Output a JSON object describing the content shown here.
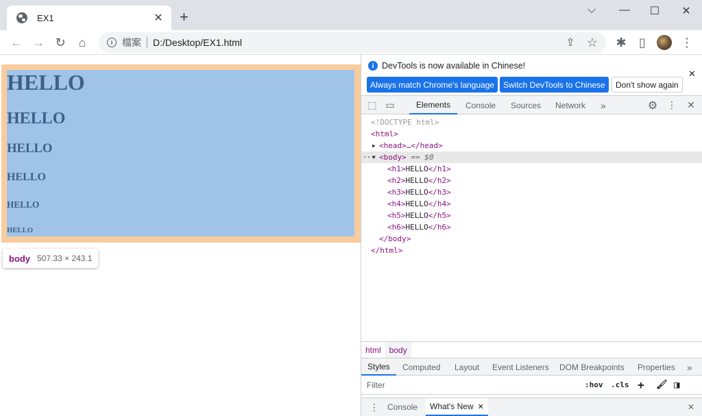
{
  "browser": {
    "tab_title": "EX1",
    "tab_close": "✕",
    "new_tab": "+",
    "controls": {
      "minimize": "⌵",
      "restore": "—",
      "maximize": "☐",
      "close": "✕"
    },
    "nav": {
      "back": "←",
      "forward": "→",
      "reload": "↻",
      "home": "⌂"
    },
    "omnibox": {
      "info": "i",
      "label": "檔案",
      "url": "D:/Desktop/EX1.html"
    },
    "actions": {
      "share": "⇪",
      "bookmark": "☆",
      "extensions": "✱",
      "sidepanel": "▯",
      "menu": "⋮"
    }
  },
  "page": {
    "headings": [
      "HELLO",
      "HELLO",
      "HELLO",
      "HELLO",
      "HELLO",
      "HELLO"
    ],
    "tooltip": {
      "tag": "body",
      "size": "507.33 × 243.1"
    },
    "colors": {
      "margin": "#f9cc9d",
      "content": "#a0c4e8",
      "text": "#3e5f86"
    }
  },
  "devtools": {
    "notice": {
      "info": "i",
      "text": "DevTools is now available in Chinese!",
      "buttons": [
        "Always match Chrome's language",
        "Switch DevTools to Chinese",
        "Don't show again"
      ],
      "close": "✕"
    },
    "tabs": [
      "Elements",
      "Console",
      "Sources",
      "Network"
    ],
    "more_tabs": "»",
    "icons": {
      "inspect": "⬚",
      "device": "▭",
      "settings": "⚙",
      "menu": "⋮",
      "close": "✕"
    },
    "dom": {
      "doctype": "<!DOCTYPE html>",
      "html_open": "<html>",
      "head": "<head>…</head>",
      "body_open": "<body>",
      "body_eq": " == $0",
      "dots": "···",
      "children": [
        {
          "open": "<h1>",
          "text": "HELLO",
          "close": "</h1>"
        },
        {
          "open": "<h2>",
          "text": "HELLO",
          "close": "</h2>"
        },
        {
          "open": "<h3>",
          "text": "HELLO",
          "close": "</h3>"
        },
        {
          "open": "<h4>",
          "text": "HELLO",
          "close": "</h4>"
        },
        {
          "open": "<h5>",
          "text": "HELLO",
          "close": "</h5>"
        },
        {
          "open": "<h6>",
          "text": "HELLO",
          "close": "</h6>"
        }
      ],
      "body_close": "</body>",
      "html_close": "</html>"
    },
    "breadcrumbs": [
      "html",
      "body"
    ],
    "styles_tabs": [
      "Styles",
      "Computed",
      "Layout",
      "Event Listeners",
      "DOM Breakpoints",
      "Properties"
    ],
    "styles_more": "»",
    "filter": {
      "placeholder": "Filter",
      "hov": ":hov",
      "cls": ".cls",
      "plus": "+",
      "paint": "🖌",
      "toggle": "◨"
    },
    "drawer": {
      "menu": "⋮",
      "tabs": [
        "Console",
        "What's New"
      ],
      "tab_close": "✕",
      "close": "✕"
    }
  }
}
